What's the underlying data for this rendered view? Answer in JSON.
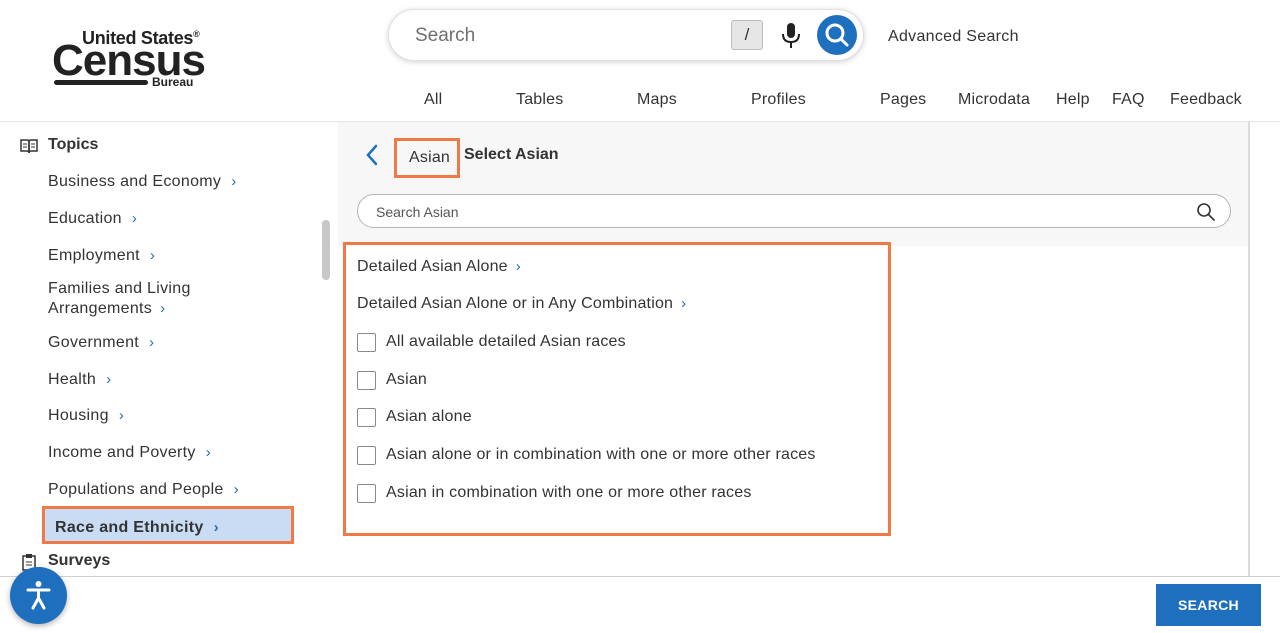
{
  "logo": {
    "line1": "United States",
    "registered": "®",
    "line2": "Census",
    "line3": "Bureau"
  },
  "search": {
    "placeholder": "Search",
    "shortcut_key": "/",
    "advanced_label": "Advanced Search"
  },
  "nav": {
    "tabs": [
      "All",
      "Tables",
      "Maps",
      "Profiles",
      "Pages",
      "Microdata",
      "Help",
      "FAQ",
      "Feedback"
    ]
  },
  "sidebar": {
    "topics_label": "Topics",
    "items": [
      "Business and Economy",
      "Education",
      "Employment",
      "Families and Living",
      "Arrangements",
      "Government",
      "Health",
      "Housing",
      "Income and Poverty",
      "Populations and People",
      "Race and Ethnicity"
    ],
    "surveys_label": "Surveys"
  },
  "panel": {
    "breadcrumb_link": "Asian",
    "title": "Select Asian",
    "search_placeholder": "Search Asian",
    "links": [
      "Detailed Asian Alone",
      "Detailed Asian Alone or in Any Combination"
    ],
    "checkboxes": [
      "All available detailed Asian races",
      "Asian",
      "Asian alone",
      "Asian alone or in combination with one or more other races",
      "Asian in combination with one or more other races"
    ]
  },
  "footer": {
    "search_button": "SEARCH"
  },
  "colors": {
    "accent_blue": "#1f6fbf",
    "highlight_orange": "#f07a46",
    "active_item_bg": "#c9dcf3"
  },
  "icons": [
    "book-icon",
    "microphone-icon",
    "search-icon",
    "chevron-right-icon",
    "chevron-left-icon",
    "clipboard-icon",
    "accessibility-icon"
  ]
}
